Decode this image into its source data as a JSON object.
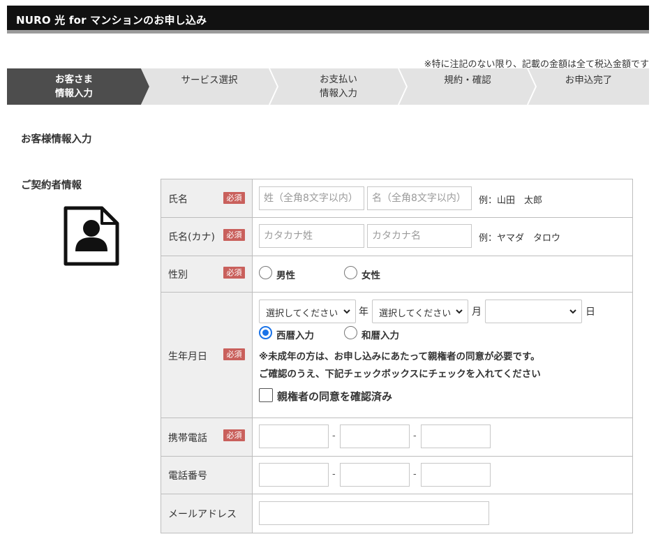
{
  "header": {
    "title": "NURO 光 for マンションのお申し込み"
  },
  "tax_note": "※特に注記のない限り、記載の金額は全て税込金額です",
  "steps": [
    {
      "line1": "お客さま",
      "line2": "情報入力",
      "active": true
    },
    {
      "line1": "サービス選択",
      "line2": "",
      "active": false
    },
    {
      "line1": "お支払い",
      "line2": "情報入力",
      "active": false
    },
    {
      "line1": "規約・確認",
      "line2": "",
      "active": false
    },
    {
      "line1": "お申込完了",
      "line2": "",
      "active": false
    }
  ],
  "section_title": "お客様情報入力",
  "contract_title": "ご契約者情報",
  "contract_icon": "person-document-icon",
  "required_badge": "必須",
  "form": {
    "name": {
      "label": "氏名",
      "last_placeholder": "姓（全角8文字以内）",
      "first_placeholder": "名（全角8文字以内）",
      "example": "例：山田　太郎"
    },
    "kana": {
      "label": "氏名(カナ)",
      "last_placeholder": "カタカナ姓",
      "first_placeholder": "カタカナ名",
      "example": "例：ヤマダ　タロウ"
    },
    "gender": {
      "label": "性別",
      "options": [
        "男性",
        "女性"
      ]
    },
    "birthday": {
      "label": "生年月日",
      "year_select": "選択してください",
      "year_unit": "年",
      "month_select": "選択してください",
      "month_unit": "月",
      "day_select": "",
      "day_unit": "日",
      "calendar_options": [
        "西暦入力",
        "和暦入力"
      ],
      "calendar_selected": "西暦入力",
      "notice_1": "※未成年の方は、お申し込みにあたって親権者の同意が必要です。",
      "notice_2": "ご確認のうえ、下記チェックボックスにチェックを入れてください",
      "consent_label": "親権者の同意を確認済み"
    },
    "mobile": {
      "label": "携帯電話",
      "separator": "-"
    },
    "phone": {
      "label": "電話番号",
      "separator": "-"
    },
    "email": {
      "label": "メールアドレス"
    }
  },
  "colors": {
    "header_bg": "#111111",
    "active_step": "#4d4d4d",
    "inactive_step": "#e3e3e3",
    "required_badge": "#c9605c",
    "radio_selected": "#1a73e8"
  }
}
